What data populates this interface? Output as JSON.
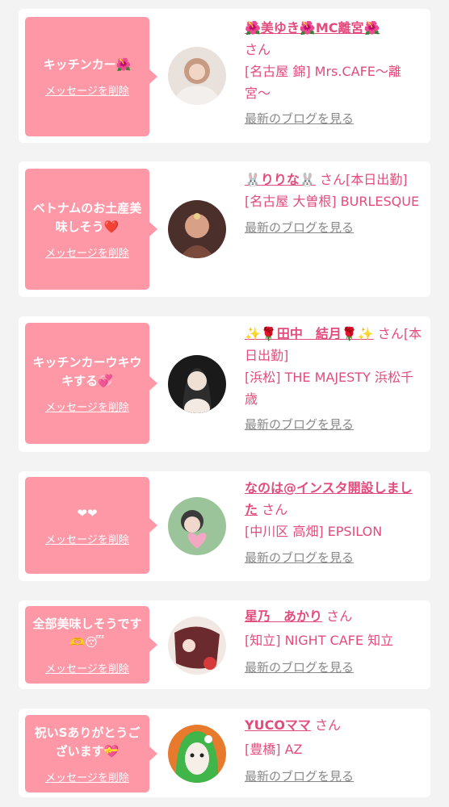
{
  "cards": [
    {
      "message": "キッチンカー🌺",
      "delete_label": "メッセージを削除",
      "name": "🌺美ゆき🌺MC離宮🌺",
      "honorific": "さん",
      "status": "",
      "location": "[名古屋 錦] Mrs.CAFE〜離宮〜",
      "blog_label": "最新のブログを見る"
    },
    {
      "message": "ベトナムのお土産美味しそう❤️",
      "delete_label": "メッセージを削除",
      "name": "🐰りりな🐰",
      "honorific": "さん",
      "status": "[本日出勤]",
      "location": "[名古屋 大曽根] BURLESQUE",
      "blog_label": "最新のブログを見る"
    },
    {
      "message": "キッチンカーウキウキする💞",
      "delete_label": "メッセージを削除",
      "name": "✨🌹田中　結月🌹✨",
      "honorific": "さん",
      "status": "[本日出勤]",
      "location": "[浜松] THE MAJESTY 浜松千歳",
      "blog_label": "最新のブログを見る"
    },
    {
      "message": "❤❤",
      "delete_label": "メッセージを削除",
      "name": "なのは@インスタ開設しました",
      "honorific": "さん",
      "status": "",
      "location": "[中川区 高畑] EPSILON",
      "blog_label": "最新のブログを見る"
    },
    {
      "message": "全部美味しそうです🫶😴",
      "delete_label": "メッセージを削除",
      "name": "星乃　あかり",
      "honorific": "さん",
      "status": "",
      "location": "[知立] NIGHT CAFE 知立",
      "blog_label": "最新のブログを見る"
    },
    {
      "message": "祝いSありがとうございます💝",
      "delete_label": "メッセージを削除",
      "name": "YUCOママ",
      "honorific": "さん",
      "status": "",
      "location": "[豊橋] AZ",
      "blog_label": "最新のブログを見る"
    }
  ]
}
